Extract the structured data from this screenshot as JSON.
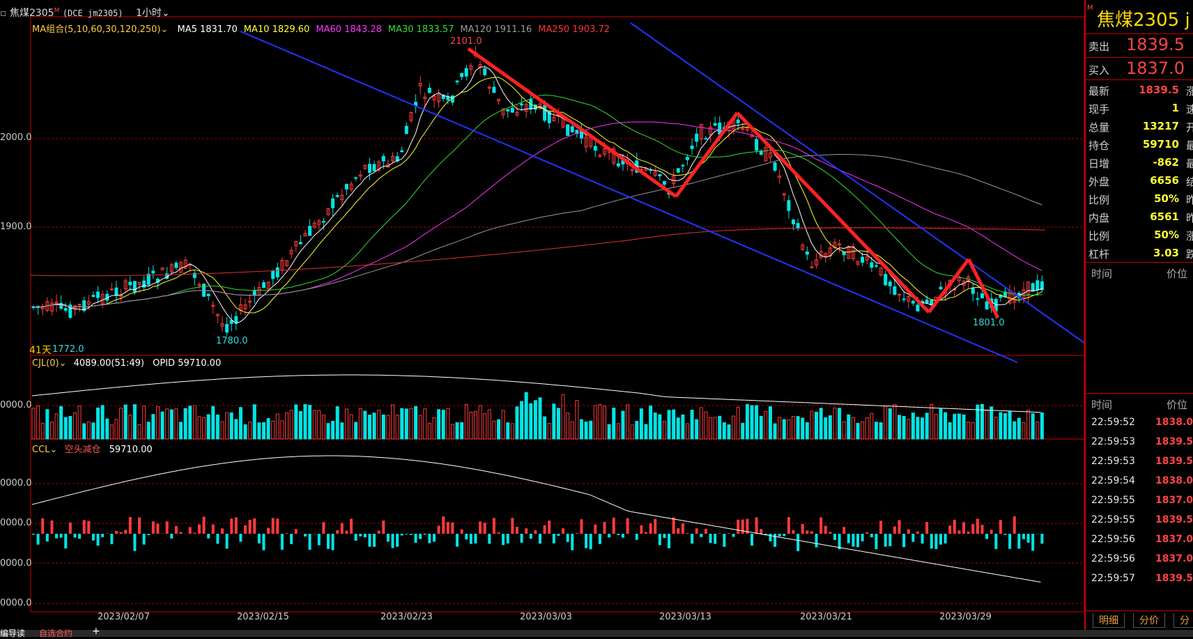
{
  "top": {
    "symbol_title": "焦煤2305",
    "symbol_flag": "M",
    "code": "(DCE jm2305)",
    "period": "1小时"
  },
  "ma_line": {
    "group_label": "MA组合(5,10,60,30,120,250)",
    "items": [
      {
        "label": "MA5 1831.70",
        "color": "#ffffff"
      },
      {
        "label": "MA10 1829.60",
        "color": "#ffff33"
      },
      {
        "label": "MA60 1843.28",
        "color": "#ff33ff"
      },
      {
        "label": "MA30 1833.57",
        "color": "#33dd33"
      },
      {
        "label": "MA120 1911.16",
        "color": "#999999"
      },
      {
        "label": "MA250 1903.72",
        "color": "#ff3333"
      }
    ]
  },
  "price_axis": {
    "ticks": [
      "2000.0",
      "1900.0"
    ]
  },
  "annotations": {
    "high": "2101.0",
    "low1": "1780.0",
    "low2": "1772.0",
    "low3": "1801.0",
    "days": "41天"
  },
  "cjl": {
    "label": "CJL(0)",
    "value": "4089.00(51:49)",
    "opid": "OPID 59710.00",
    "tick": "0000.0"
  },
  "ccl": {
    "label": "CCL",
    "status": "空头减仓",
    "value": "59710.00",
    "ticks": [
      "0000.0",
      "0000.0",
      "0000.0",
      "0000.0"
    ]
  },
  "dates": [
    "2023/02/07",
    "2023/02/15",
    "2023/02/23",
    "2023/03/03",
    "2023/03/13",
    "2023/03/21",
    "2023/03/29"
  ],
  "side": {
    "title": "焦煤2305",
    "title_suffix": "j",
    "sell_label": "卖出",
    "sell_price": "1839.5",
    "buy_label": "买入",
    "buy_price": "1837.0",
    "stats": [
      {
        "label": "最新",
        "value": "1839.5",
        "color": "#ff4444",
        "right": "涨"
      },
      {
        "label": "现手",
        "value": "1",
        "color": "#ffff33",
        "right": "速"
      },
      {
        "label": "总量",
        "value": "13217",
        "color": "#ffff33",
        "right": "开"
      },
      {
        "label": "持仓",
        "value": "59710",
        "color": "#ffff33",
        "right": "最"
      },
      {
        "label": "日增",
        "value": "-862",
        "color": "#ffff33",
        "right": "最"
      },
      {
        "label": "外盘",
        "value": "6656",
        "color": "#ffff33",
        "right": "结"
      },
      {
        "label": "比例",
        "value": "50%",
        "color": "#ffff33",
        "right": "昨"
      },
      {
        "label": "内盘",
        "value": "6561",
        "color": "#ffff33",
        "right": "昨"
      },
      {
        "label": "比例",
        "value": "50%",
        "color": "#ffff33",
        "right": "涨"
      },
      {
        "label": "杠杆",
        "value": "3.03",
        "color": "#ffff33",
        "right": "跌"
      }
    ],
    "tick_header1": {
      "time": "时间",
      "price": "价位"
    },
    "tick_header2": {
      "time": "时间",
      "price": "价位"
    },
    "ticks": [
      {
        "time": "22:59:52",
        "price": "1838.0",
        "color": "#ff4444"
      },
      {
        "time": "22:59:53",
        "price": "1839.5",
        "color": "#ff4444"
      },
      {
        "time": "22:59:53",
        "price": "1839.5",
        "color": "#ff4444"
      },
      {
        "time": "22:59:54",
        "price": "1838.0",
        "color": "#ff4444"
      },
      {
        "time": "22:59:55",
        "price": "1837.0",
        "color": "#ff4444"
      },
      {
        "time": "22:59:55",
        "price": "1839.5",
        "color": "#ff4444"
      },
      {
        "time": "22:59:56",
        "price": "1837.0",
        "color": "#ff4444"
      },
      {
        "time": "22:59:56",
        "price": "1837.0",
        "color": "#ff4444"
      },
      {
        "time": "22:59:57",
        "price": "1839.5",
        "color": "#ff4444"
      }
    ],
    "tabs": [
      "明细",
      "分价",
      "分"
    ]
  },
  "bottom": {
    "items": [
      "编导读",
      "自选合约",
      "+"
    ]
  }
}
